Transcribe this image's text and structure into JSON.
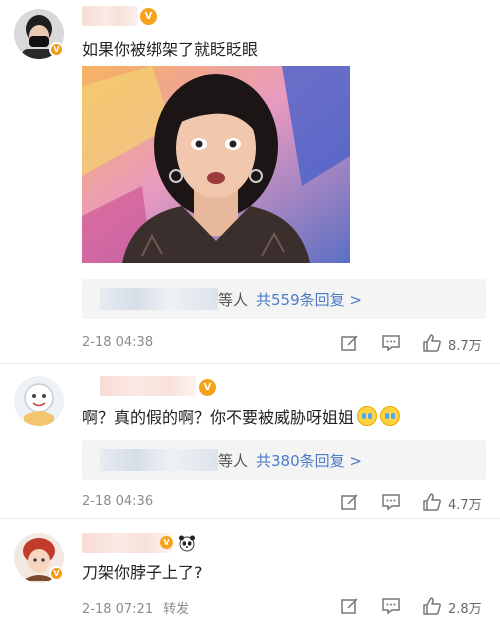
{
  "comments": [
    {
      "text": "如果你被绑架了就眨眨眼",
      "reply_by": "等人",
      "reply_link": "共559条回复 >",
      "time": "2-18 04:38",
      "forward": "",
      "likes": "8.7万"
    },
    {
      "text": "啊？真的假的啊？你不要被威胁呀姐姐",
      "reply_by": "等人",
      "reply_link": "共380条回复 >",
      "time": "2-18 04:36",
      "forward": "",
      "likes": "4.7万"
    },
    {
      "text": "刀架你脖子上了?",
      "time": "2-18 07:21",
      "forward": "转发",
      "likes": "2.8万"
    }
  ],
  "icons": {
    "edit": "edit-icon",
    "comment": "comment-icon",
    "like": "thumbs-up-icon",
    "emoji_crying": "crying-emoji-icon",
    "panda": "panda-icon",
    "vip": "vip-badge-icon"
  },
  "colors": {
    "link": "#4c7ac7",
    "meta": "#8c8c8c",
    "badge": "#f29b18",
    "reply_bg": "#f4f4f4"
  }
}
